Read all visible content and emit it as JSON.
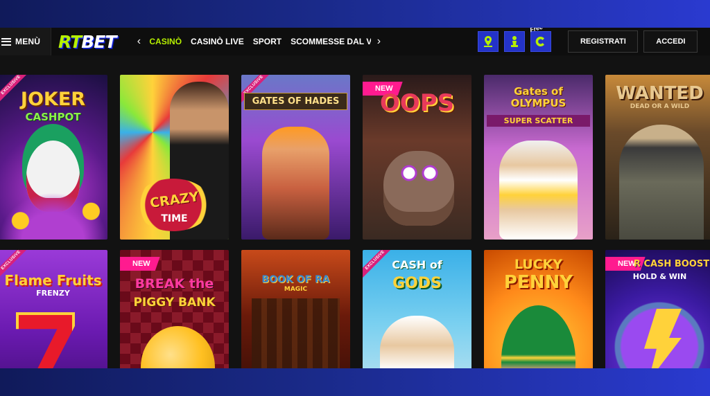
{
  "header": {
    "menu_label": "MENÙ",
    "logo_rt": "RT",
    "logo_bet": "BET",
    "nav_items": [
      "CASINÒ",
      "CASINÒ LIVE",
      "SPORT",
      "SCOMMESSE DAL VIVO"
    ],
    "active_nav": "CASINÒ",
    "prev_arrow": "‹",
    "next_arrow": "›",
    "icons": [
      "map-pin-icon",
      "chess-pawn-icon",
      "free-c-icon"
    ],
    "free_badge": "Free",
    "register_label": "REGISTRATI",
    "login_label": "ACCEDI"
  },
  "colors": {
    "accent": "#b6f000",
    "brand_blue": "#2433c8",
    "new_tag": "#ff1b8f",
    "exclusive_ribbon": "#d8217a"
  },
  "games": [
    {
      "title": "JOKER",
      "subtitle": "CASHPOT",
      "tag": "EXCLUSIVE"
    },
    {
      "title": "CRAZY",
      "subtitle": "TIME",
      "tag": ""
    },
    {
      "title": "GATES OF HADES",
      "subtitle": "",
      "tag": "EXCLUSIVE"
    },
    {
      "title": "OOPS",
      "subtitle": "",
      "tag": "NEW"
    },
    {
      "title": "Gates of OLYMPUS",
      "subtitle": "SUPER SCATTER",
      "tag": ""
    },
    {
      "title": "WANTED",
      "subtitle": "DEAD OR A WILD",
      "tag": ""
    },
    {
      "title": "Flame Fruits",
      "subtitle": "FRENZY",
      "tag": "EXCLUSIVE"
    },
    {
      "title": "BREAK the",
      "subtitle": "PIGGY BANK",
      "tag": "NEW"
    },
    {
      "title": "BOOK OF RA",
      "subtitle": "MAGIC",
      "tag": ""
    },
    {
      "title": "CASH of",
      "subtitle": "GODS",
      "tag": "EXCLUSIVE"
    },
    {
      "title": "LUCKY",
      "subtitle": "PENNY",
      "tag": ""
    },
    {
      "title": "R CASH BOOST",
      "subtitle": "HOLD & WIN",
      "tag": "NEW"
    }
  ]
}
